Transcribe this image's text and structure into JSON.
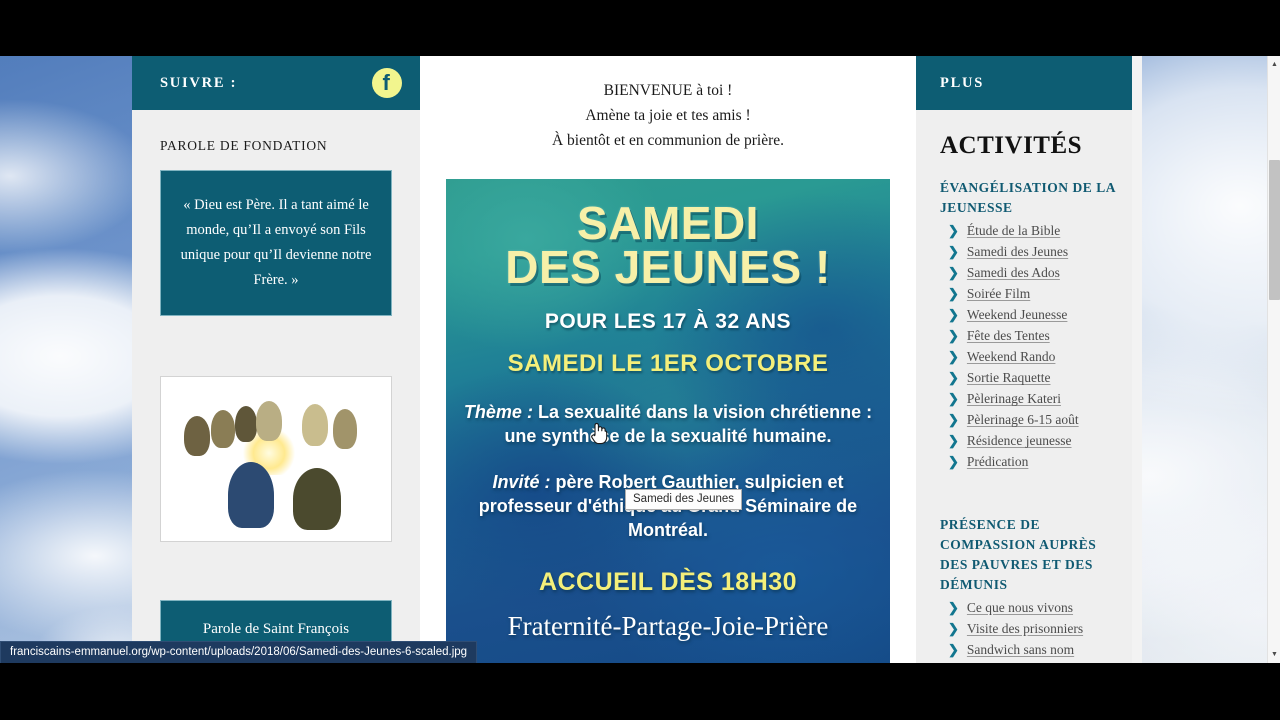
{
  "browser": {
    "status_url": "franciscains-emmanuel.org/wp-content/uploads/2018/06/Samedi-des-Jeunes-6-scaled.jpg",
    "tooltip": "Samedi des Jeunes",
    "scroll_up_arrow": "▲",
    "scroll_down_arrow": "▼"
  },
  "theme": {
    "teal": "#0d5d73",
    "link_teal": "#105a72",
    "poster_yellow": "#f4ef7a",
    "panel_grey": "#efefef"
  },
  "left_column": {
    "header_label": "SUIVRE :",
    "facebook_icon_glyph": "f",
    "section_label": "PAROLE DE FONDATION",
    "quote": "« Dieu est Père. Il a tant aimé le monde, qu’Il a envoyé son Fils unique pour qu’Il devienne notre Frère. »",
    "image_alt": "Nativité entourée de Franciscains",
    "caption": "Parole de Saint François"
  },
  "center_column": {
    "welcome": [
      "BIENVENUE à toi !",
      "Amène ta joie et tes amis !",
      "À bientôt et en communion de prière."
    ],
    "poster": {
      "title_line1": "SAMEDI",
      "title_line2": "DES JEUNES !",
      "age_line": "POUR LES 17 À 32 ANS",
      "date_line": "SAMEDI LE 1ER OCTOBRE",
      "theme_label": "Thème :",
      "theme_text": "La sexualité dans la vision chrétienne : une synthèse de la sexualité humaine.",
      "guest_label": "Invité :",
      "guest_text": "père Robert Gauthier, sulpicien et professeur d'éthique au Grand Séminaire de Montréal.",
      "welcome_time": "ACCUEIL DÈS 18H30",
      "motto": "Fraternité-Partage-Joie-Prière"
    }
  },
  "right_column": {
    "header_label": "PLUS",
    "title": "ACTIVITÉS",
    "groups": [
      {
        "title": "ÉVANGÉLISATION DE LA JEUNESSE",
        "links": [
          "Étude de la Bible",
          "Samedi des Jeunes",
          "Samedi des Ados",
          "Soirée Film",
          "Weekend Jeunesse",
          "Fête des Tentes",
          "Weekend Rando",
          "Sortie Raquette",
          "Pèlerinage Kateri",
          "Pèlerinage 6-15 août",
          "Résidence jeunesse",
          "Prédication"
        ]
      },
      {
        "title": "PRÉSENCE DE COMPASSION AUPRÈS DES PAUVRES ET DES DÉMUNIS",
        "links": [
          "Ce que nous vivons",
          "Visite des prisonniers",
          "Sandwich sans nom"
        ]
      }
    ]
  },
  "icons": {
    "chevron": "❯",
    "facebook": "facebook-icon"
  }
}
